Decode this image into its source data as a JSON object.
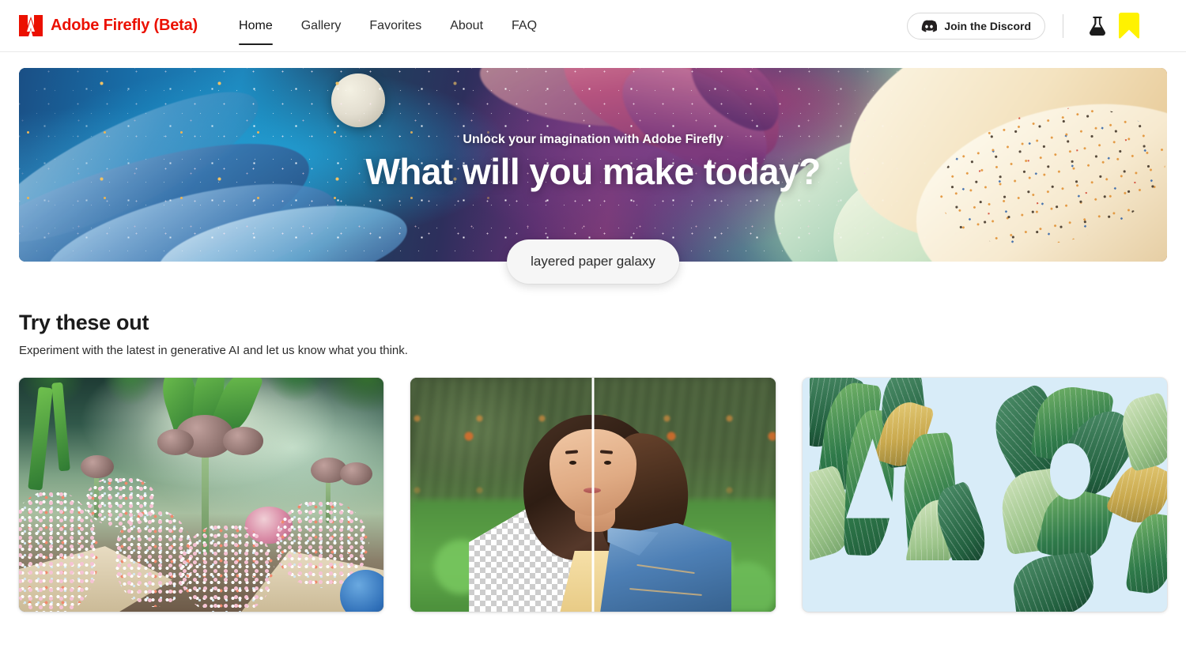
{
  "header": {
    "brand_name": "Adobe Firefly (Beta)",
    "brand_color": "#EB1000",
    "logo_icon": "adobe-a-logo",
    "nav": [
      {
        "label": "Home",
        "active": true
      },
      {
        "label": "Gallery",
        "active": false
      },
      {
        "label": "Favorites",
        "active": false
      },
      {
        "label": "About",
        "active": false
      },
      {
        "label": "FAQ",
        "active": false
      }
    ],
    "discord_button": {
      "label": "Join the Discord",
      "icon": "discord-icon"
    },
    "beaker_icon": "flask-beaker-icon",
    "bookmark_icon": "bookmark-icon",
    "bookmark_color": "#FFF200"
  },
  "hero": {
    "eyebrow": "Unlock your imagination with Adobe Firefly",
    "title": "What will you make today?",
    "prompt_pill": "layered paper galaxy",
    "artwork_alt": "layered paper galaxy"
  },
  "section": {
    "title": "Try these out",
    "subtitle": "Experiment with the latest in generative AI and let us know what you think."
  },
  "cards": [
    {
      "alt": "fantasy garden with mushroom plants and flowers"
    },
    {
      "alt": "portrait of a woman, before and after generative fill with denim jacket"
    },
    {
      "alt": "letters A and g made of tropical leaves on light blue background"
    }
  ]
}
